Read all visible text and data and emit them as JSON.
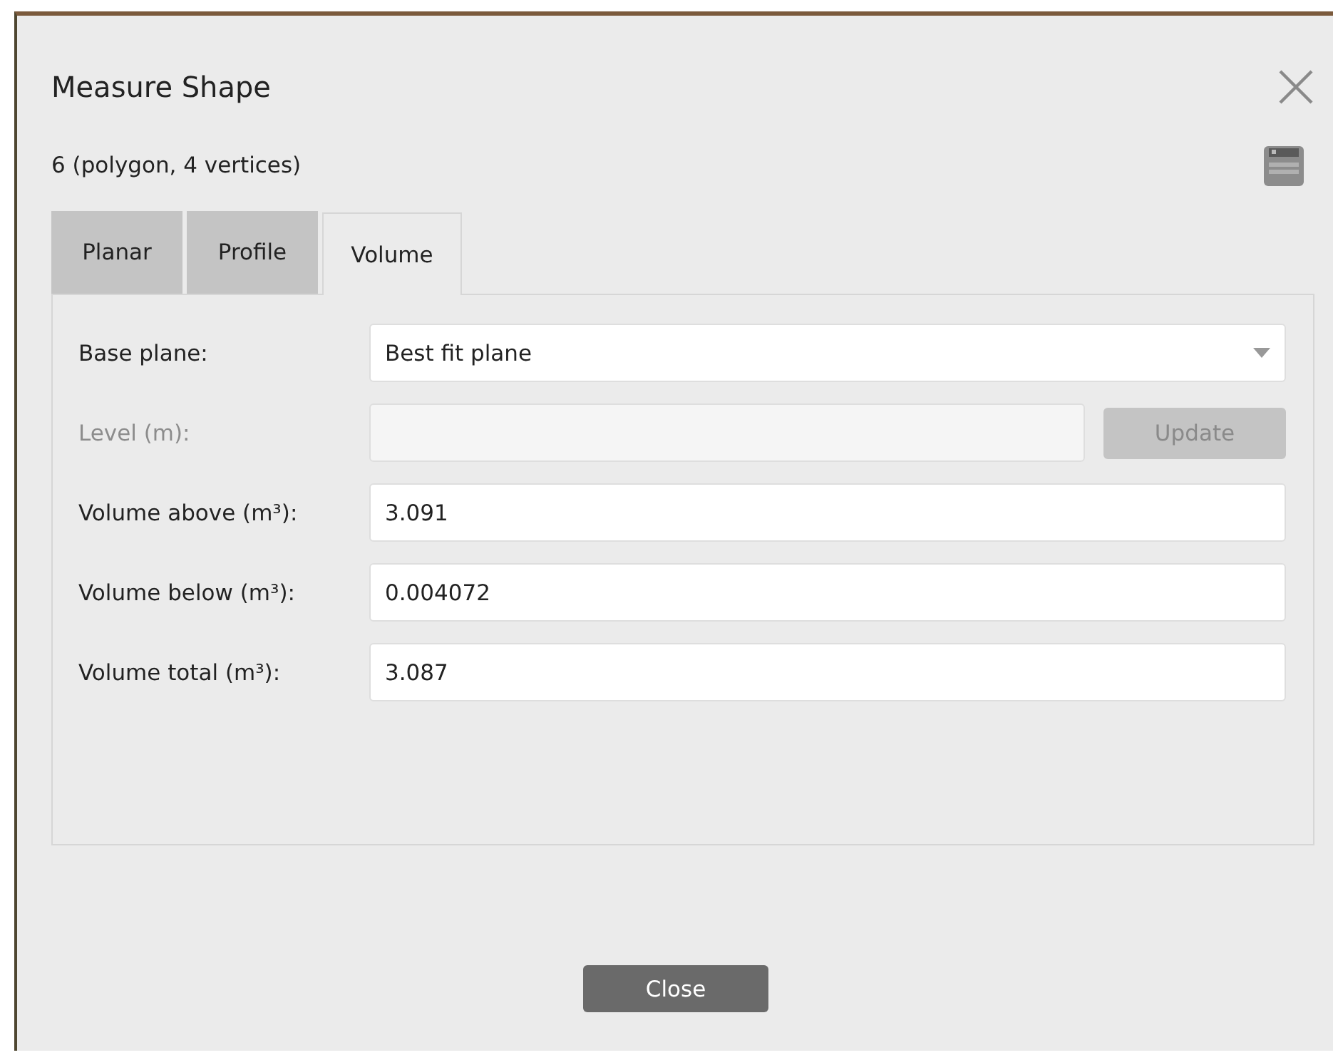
{
  "dialog": {
    "title": "Measure Shape",
    "subtitle": "6 (polygon, 4 vertices)"
  },
  "tabs": [
    {
      "label": "Planar",
      "selected": false
    },
    {
      "label": "Profile",
      "selected": false
    },
    {
      "label": "Volume",
      "selected": true
    }
  ],
  "fields": [
    {
      "kind": "dropdown",
      "label": "Base plane:",
      "value": "Best fit plane",
      "disabled": false
    },
    {
      "kind": "input_button",
      "label": "Level (m):",
      "button": "Update",
      "disabled": true
    },
    {
      "kind": "input",
      "label": "Volume above (m³):",
      "value": "3.091",
      "disabled": false
    },
    {
      "kind": "input",
      "label": "Volume below (m³):",
      "value": "0.004072",
      "disabled": false
    },
    {
      "kind": "input",
      "label": "Volume total (m³):",
      "value": "3.087",
      "disabled": false
    }
  ],
  "close_button": "Close"
}
